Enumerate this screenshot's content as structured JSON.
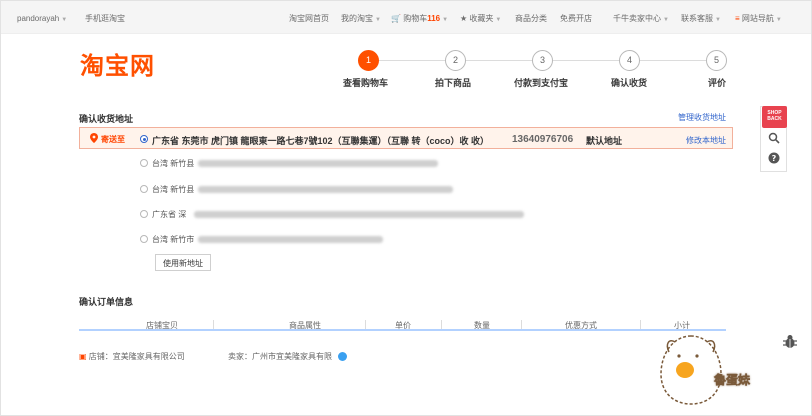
{
  "topbar": {
    "user": "pandorayah",
    "mobile": "手机逛淘宝",
    "home": "淘宝网首页",
    "my_taobao": "我的淘宝",
    "cart_label": "购物车",
    "cart_count": "116",
    "favorites": "收藏夹",
    "categories": "商品分类",
    "open_shop": "免费开店",
    "seller_center": "千牛卖家中心",
    "support": "联系客服",
    "site_nav": "网站导航"
  },
  "header": {
    "logo": "淘宝网",
    "steps": [
      {
        "num": "1",
        "label": "查看购物车"
      },
      {
        "num": "2",
        "label": "拍下商品"
      },
      {
        "num": "3",
        "label": "付款到支付宝"
      },
      {
        "num": "4",
        "label": "确认收货"
      },
      {
        "num": "5",
        "label": "评价"
      }
    ]
  },
  "address": {
    "title": "确认收货地址",
    "manage": "管理收货地址",
    "send_to": "寄送至",
    "selected": {
      "text": "广东省 东莞市 虎门镇 龍眼東一路七巷7號102（互聯集運）（互聯 转（coco）收 收）",
      "phone": "13640976706",
      "default": "默认地址",
      "edit": "修改本地址"
    },
    "others": [
      {
        "prefix": "台湾 新竹县"
      },
      {
        "prefix": "台湾 新竹县"
      },
      {
        "prefix": "广东省 深"
      },
      {
        "prefix": "台湾 新竹市"
      }
    ],
    "new_address": "使用新地址"
  },
  "order": {
    "title": "确认订单信息",
    "columns": [
      "店铺宝贝",
      "商品属性",
      "单价",
      "数量",
      "优惠方式",
      "小计"
    ],
    "shop_label": "店铺：宜美隆家具有限公司",
    "seller_label": "卖家：广州市宜美隆家具有限"
  },
  "side": {
    "shopback": "SHOP BACK"
  },
  "mascot": {
    "text": "魯蛋妹"
  },
  "colors": {
    "brand": "#ff5000",
    "link": "#3366cc",
    "address_bg": "#fff3eb"
  }
}
